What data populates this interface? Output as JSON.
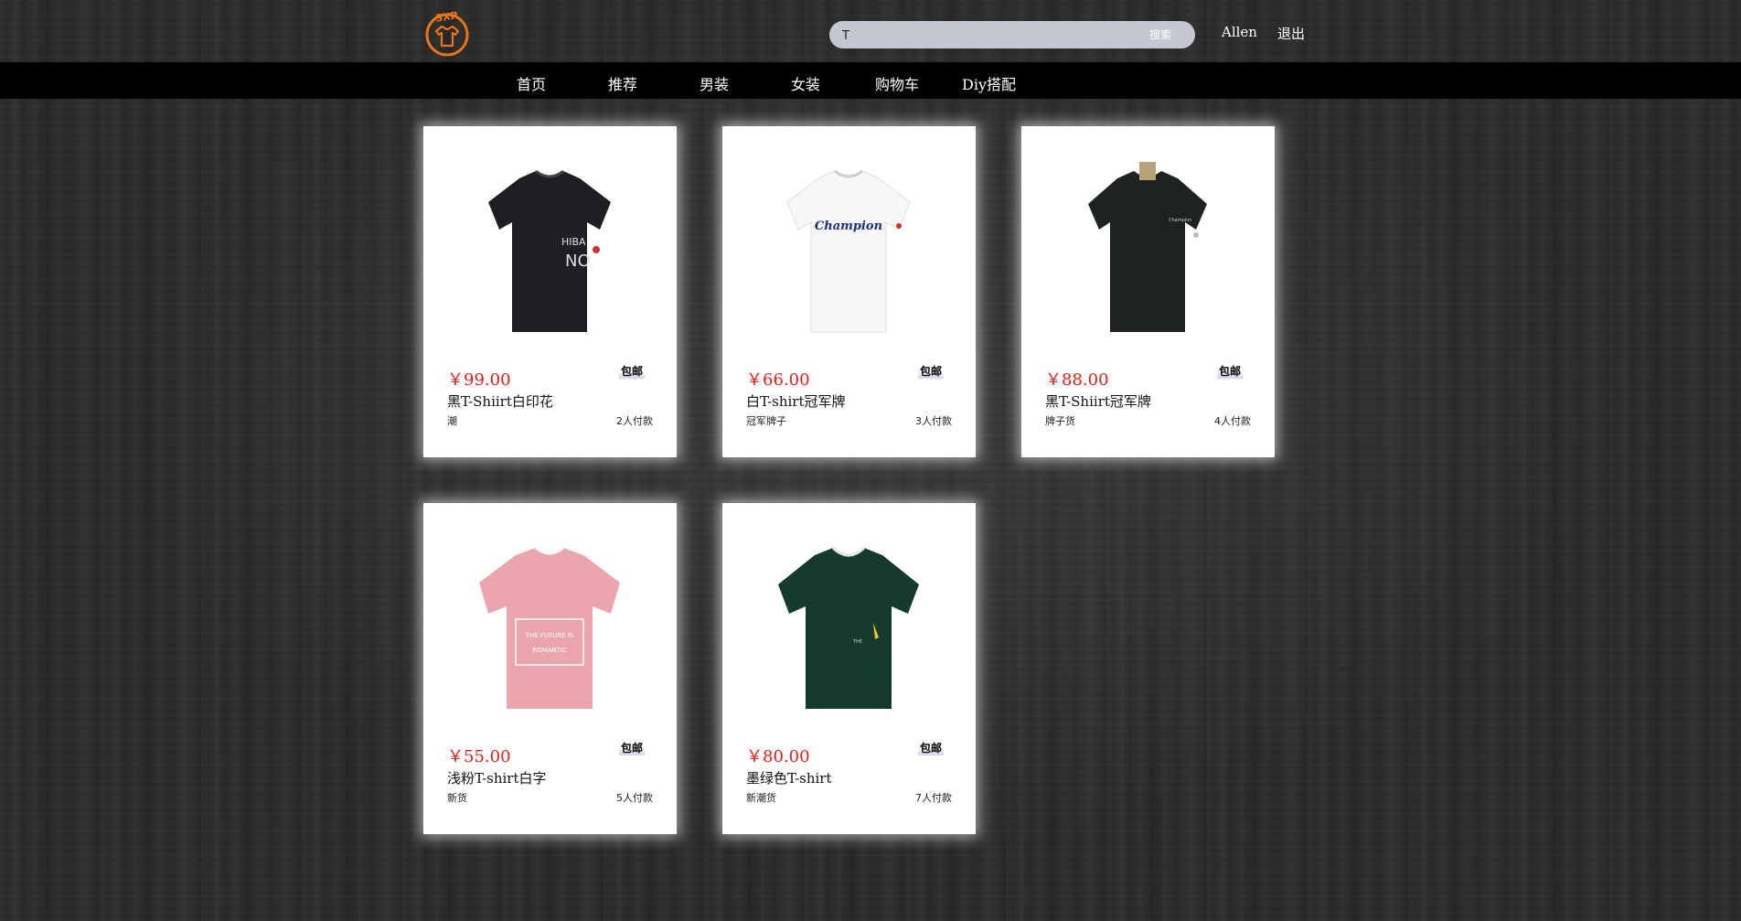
{
  "header": {
    "logo_text": "SXP",
    "search_value": "T",
    "search_button": "搜索",
    "username": "Allen",
    "logout": "退出"
  },
  "nav": [
    "首页",
    "推荐",
    "男装",
    "女装",
    "购物车",
    "Diy搭配"
  ],
  "products": [
    {
      "price": "￥99.00",
      "badge": "包邮",
      "name": "黑T-Shiirt白印花",
      "tag": "潮",
      "sold": "2人付款",
      "shirt_color": "#1e1f24",
      "print": "graphic"
    },
    {
      "price": "￥66.00",
      "badge": "包邮",
      "name": "白T-shirt冠军牌",
      "tag": "冠军牌子",
      "sold": "3人付款",
      "shirt_color": "#f7f7f7",
      "print": "Champion"
    },
    {
      "price": "￥88.00",
      "badge": "包邮",
      "name": "黑T-Shiirt冠军牌",
      "tag": "牌子货",
      "sold": "4人付款",
      "shirt_color": "#1f2320",
      "print": "small-logo"
    },
    {
      "price": "￥55.00",
      "badge": "包邮",
      "name": "浅粉T-shirt白字",
      "tag": "新货",
      "sold": "5人付款",
      "shirt_color": "#eba5ad",
      "print": "THE FUTURE IS ROMANTIC"
    },
    {
      "price": "￥80.00",
      "badge": "包邮",
      "name": "墨绿色T-shirt",
      "tag": "新潮货",
      "sold": "7人付款",
      "shirt_color": "#173a2e",
      "print": "rocket"
    }
  ]
}
